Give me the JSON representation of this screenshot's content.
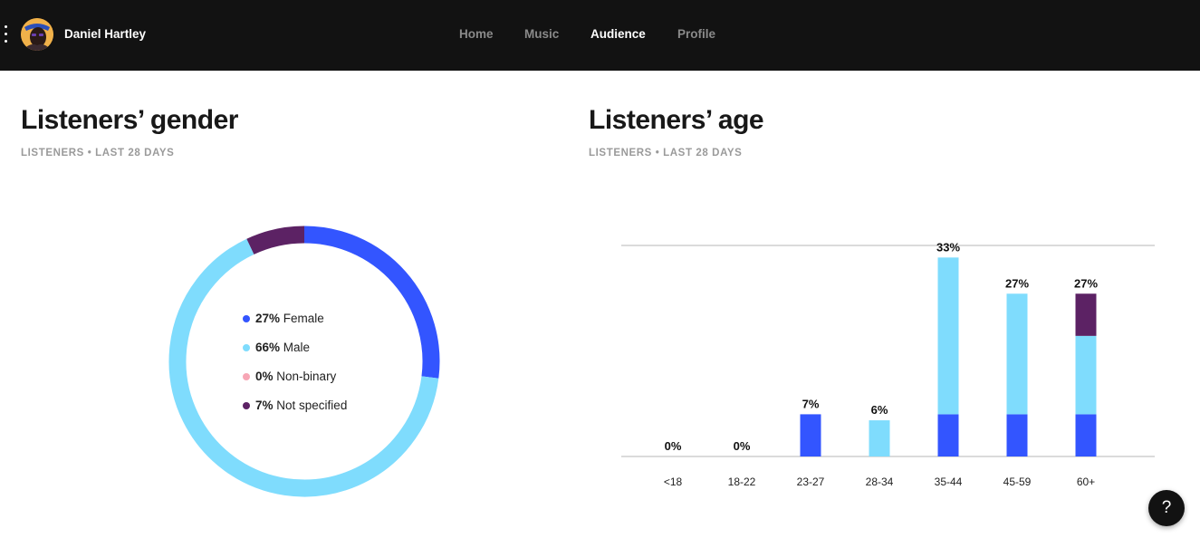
{
  "header": {
    "artist_name": "Daniel Hartley",
    "nav": [
      {
        "label": "Home",
        "active": false
      },
      {
        "label": "Music",
        "active": false
      },
      {
        "label": "Audience",
        "active": true
      },
      {
        "label": "Profile",
        "active": false
      }
    ],
    "menu_icon": "vertical-dots-icon",
    "avatar": "artist-avatar"
  },
  "gender": {
    "title": "Listeners’ gender",
    "subtitle": "LISTENERS • LAST 28 DAYS",
    "legend": [
      {
        "pct": "27%",
        "label": "Female",
        "color": "#3355ff"
      },
      {
        "pct": "66%",
        "label": "Male",
        "color": "#7fdcfd"
      },
      {
        "pct": "0%",
        "label": "Non-binary",
        "color": "#f7a6b5"
      },
      {
        "pct": "7%",
        "label": "Not specified",
        "color": "#5c2264"
      }
    ]
  },
  "age": {
    "title": "Listeners’ age",
    "subtitle": "LISTENERS • LAST 28 DAYS"
  },
  "chart_data": [
    {
      "type": "pie",
      "categories": [
        "Female",
        "Male",
        "Non-binary",
        "Not specified"
      ],
      "values": [
        27,
        66,
        0,
        7
      ],
      "colors": [
        "#3355ff",
        "#7fdcfd",
        "#f7a6b5",
        "#5c2264"
      ],
      "donut": true
    },
    {
      "type": "bar",
      "stacked": true,
      "categories": [
        "<18",
        "18-22",
        "23-27",
        "28-34",
        "35-44",
        "45-59",
        "60+"
      ],
      "value_labels": [
        "0%",
        "0%",
        "7%",
        "6%",
        "33%",
        "27%",
        "27%"
      ],
      "totals": [
        0,
        0,
        7,
        6,
        33,
        27,
        27
      ],
      "series": [
        {
          "color": "#3355ff",
          "values": [
            0,
            0,
            7,
            0,
            7,
            7,
            7
          ]
        },
        {
          "color": "#7fdcfd",
          "values": [
            0,
            0,
            0,
            6,
            26,
            20,
            13
          ]
        },
        {
          "color": "#5c2264",
          "values": [
            0,
            0,
            0,
            0,
            0,
            0,
            7
          ]
        }
      ],
      "ylim": [
        0,
        35
      ],
      "grid": true
    }
  ],
  "help_button": {
    "label": "?"
  }
}
